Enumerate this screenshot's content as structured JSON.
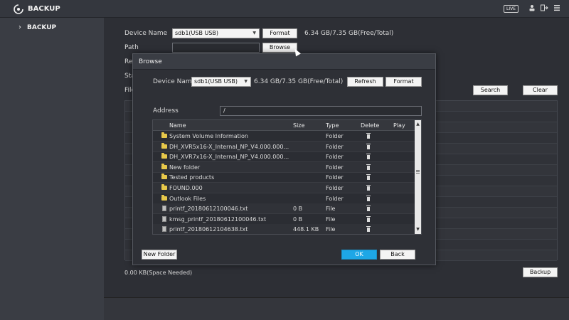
{
  "header": {
    "title": "BACKUP",
    "live_label": "LIVE"
  },
  "sidebar": {
    "items": [
      {
        "label": "BACKUP"
      }
    ]
  },
  "backup": {
    "device_name_label": "Device Name",
    "device_name_value": "sdb1(USB USB)",
    "format_label": "Format",
    "capacity": "6.34 GB/7.35 GB(Free/Total)",
    "path_label": "Path",
    "path_value": "",
    "browse_label": "Browse",
    "rec_label": "Rec",
    "start_label": "Sta",
    "file_label": "File",
    "search_label": "Search",
    "clear_label": "Clear",
    "space_needed": "0.00 KB(Space Needed)",
    "backup_label": "Backup"
  },
  "dialog": {
    "title": "Browse",
    "device_name_label": "Device Name",
    "device_name_value": "sdb1(USB USB)",
    "capacity": "6.34 GB/7.35 GB(Free/Total)",
    "refresh_label": "Refresh",
    "format_label": "Format",
    "address_label": "Address",
    "address_value": "/",
    "columns": {
      "name": "Name",
      "size": "Size",
      "type": "Type",
      "delete": "Delete",
      "play": "Play"
    },
    "rows": [
      {
        "name": "System Volume Information",
        "size": "",
        "type": "Folder",
        "kind": "folder"
      },
      {
        "name": "DH_XVR5x16-X_Internal_NP_V4.000.000...",
        "size": "",
        "type": "Folder",
        "kind": "folder"
      },
      {
        "name": "DH_XVR7x16-X_Internal_NP_V4.000.000...",
        "size": "",
        "type": "Folder",
        "kind": "folder"
      },
      {
        "name": "New folder",
        "size": "",
        "type": "Folder",
        "kind": "folder"
      },
      {
        "name": "Tested products",
        "size": "",
        "type": "Folder",
        "kind": "folder"
      },
      {
        "name": "FOUND.000",
        "size": "",
        "type": "Folder",
        "kind": "folder"
      },
      {
        "name": "Outlook Files",
        "size": "",
        "type": "Folder",
        "kind": "folder"
      },
      {
        "name": "printf_20180612100046.txt",
        "size": "0 B",
        "type": "File",
        "kind": "file"
      },
      {
        "name": "kmsg_printf_20180612100046.txt",
        "size": "0 B",
        "type": "File",
        "kind": "file"
      },
      {
        "name": "printf_20180612104638.txt",
        "size": "448.1 KB",
        "type": "File",
        "kind": "file"
      }
    ],
    "new_folder_label": "New Folder",
    "ok_label": "OK",
    "back_label": "Back"
  },
  "colors": {
    "accent": "#1ea7e6",
    "folder": "#e7c84a"
  },
  "icons": [
    "logo-icon",
    "user-icon",
    "logout-icon",
    "menu-icon",
    "chevron-right-icon",
    "folder-icon",
    "file-icon",
    "trash-icon",
    "mouse-cursor-icon"
  ]
}
